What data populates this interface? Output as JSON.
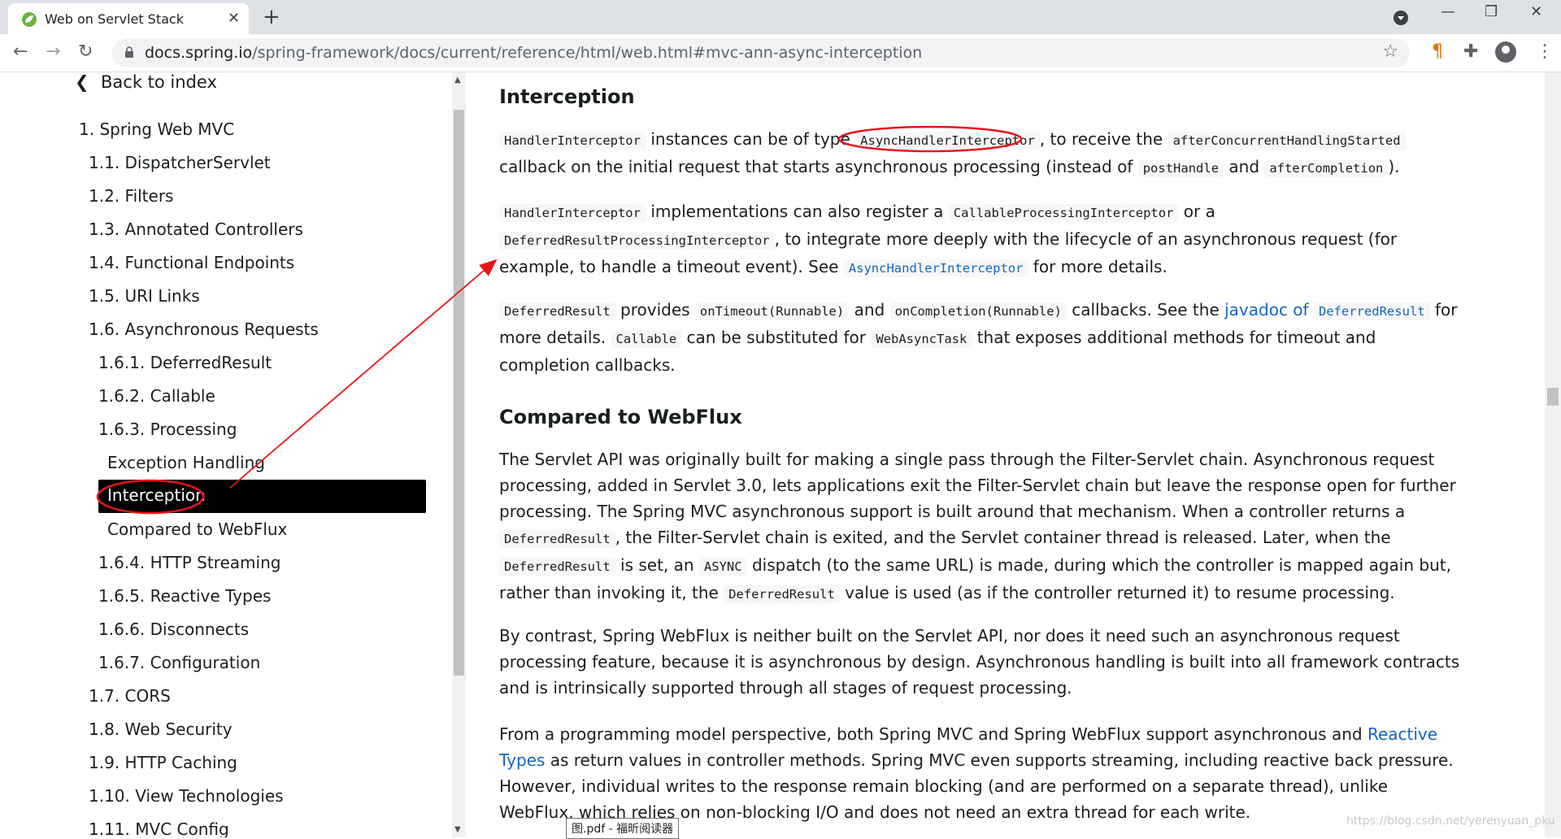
{
  "browser": {
    "tab_title": "Web on Servlet Stack",
    "url_host": "docs.spring.io",
    "url_path": "/spring-framework/docs/current/reference/html/web.html#mvc-ann-async-interception"
  },
  "toc": {
    "back": "Back to index",
    "items": [
      "1. Spring Web MVC",
      "1.1. DispatcherServlet",
      "1.2. Filters",
      "1.3. Annotated Controllers",
      "1.4. Functional Endpoints",
      "1.5. URI Links",
      "1.6. Asynchronous Requests",
      "1.6.1. DeferredResult",
      "1.6.2. Callable",
      "1.6.3. Processing",
      "Exception Handling",
      "Interception",
      "Compared to WebFlux",
      "1.6.4. HTTP Streaming",
      "1.6.5. Reactive Types",
      "1.6.6. Disconnects",
      "1.6.7. Configuration",
      "1.7. CORS",
      "1.8. Web Security",
      "1.9. HTTP Caching",
      "1.10. View Technologies",
      "1.11. MVC Config"
    ]
  },
  "content": {
    "h_interception": "Interception",
    "p1": {
      "c1": "HandlerInterceptor",
      "t1": " instances can be of type ",
      "c2": "AsyncHandlerInterceptor",
      "t2": ", to receive the ",
      "c3": "afterConcurrentHandlingStarted",
      "t3": " callback on the initial request that starts asynchronous processing (instead of ",
      "c4": "postHandle",
      "t4": " and ",
      "c5": "afterCompletion",
      "t5": ")."
    },
    "p2": {
      "c1": "HandlerInterceptor",
      "t1": " implementations can also register a ",
      "c2": "CallableProcessingInterceptor",
      "t2": " or a ",
      "c3": "DeferredResultProcessingInterceptor",
      "t3": ", to integrate more deeply with the lifecycle of an asynchronous request (for example, to handle a timeout event). See ",
      "c4": "AsyncHandlerInterceptor",
      "t4": " for more details."
    },
    "p3": {
      "c1": "DeferredResult",
      "t1": " provides ",
      "c2": "onTimeout(Runnable)",
      "t2": " and ",
      "c3": "onCompletion(Runnable)",
      "t3": " callbacks. See the ",
      "l1": "javadoc of ",
      "c4": "DeferredResult",
      "t4": " for more details. ",
      "c5": "Callable",
      "t5": " can be substituted for ",
      "c6": "WebAsyncTask",
      "t6": " that exposes additional methods for timeout and completion callbacks."
    },
    "h_webflux": "Compared to WebFlux",
    "p4": {
      "t1": "The Servlet API was originally built for making a single pass through the Filter-Servlet chain. Asynchronous request processing, added in Servlet 3.0, lets applications exit the Filter-Servlet chain but leave the response open for further processing. The Spring MVC asynchronous support is built around that mechanism. When a controller returns a ",
      "c1": "DeferredResult",
      "t2": ", the Filter-Servlet chain is exited, and the Servlet container thread is released. Later, when the ",
      "c2": "DeferredResult",
      "t3": " is set, an ",
      "c3": "ASYNC",
      "t4": " dispatch (to the same URL) is made, during which the controller is mapped again but, rather than invoking it, the ",
      "c4": "DeferredResult",
      "t5": " value is used (as if the controller returned it) to resume processing."
    },
    "p5": "By contrast, Spring WebFlux is neither built on the Servlet API, nor does it need such an asynchronous request processing feature, because it is asynchronous by design. Asynchronous handling is built into all framework contracts and is intrinsically supported through all stages of request processing.",
    "p6": {
      "t1": "From a programming model perspective, both Spring MVC and Spring WebFlux support asynchronous and ",
      "l1": "Reactive Types",
      "t2": " as return values in controller methods. Spring MVC even supports streaming, including reactive back pressure. However, individual writes to the response remain blocking (and are performed on a separate thread), unlike WebFlux, which relies on non-blocking I/O and does not need an extra thread for each write."
    }
  },
  "overlay": {
    "tooltip": "图.pdf - 福昕阅读器",
    "watermark": "https://blog.csdn.net/yerenyuan_pku"
  },
  "colors": {
    "annotation": "#e8141b",
    "link": "#1565c0",
    "active_bg": "#000000"
  }
}
